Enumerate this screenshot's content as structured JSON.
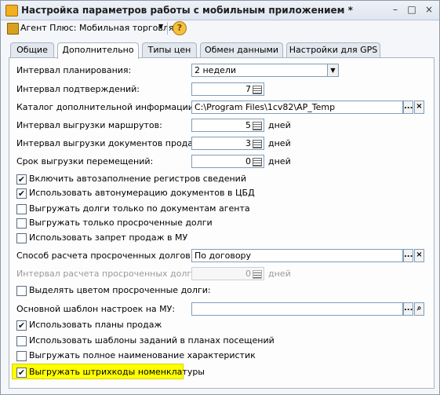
{
  "window": {
    "title": "Настройка параметров работы с мобильным приложением *",
    "buttons": {
      "minimize": "–",
      "maximize": "□",
      "close": "×"
    }
  },
  "toolbar": {
    "agent_menu_label": "Агент Плюс: Мобильная торговля",
    "help_label": "?"
  },
  "tabs": [
    {
      "label": "Общие",
      "active": false
    },
    {
      "label": "Дополнительно",
      "active": true
    },
    {
      "label": "Типы цен",
      "active": false
    },
    {
      "label": "Обмен данными",
      "active": false
    },
    {
      "label": "Настройки для GPS",
      "active": false
    }
  ],
  "form": {
    "planning_interval": {
      "label": "Интервал планирования:",
      "value": "2 недели"
    },
    "confirmation_interval": {
      "label": "Интервал подтверждений:",
      "value": "7"
    },
    "extra_info_dir": {
      "label": "Каталог дополнительной информации:",
      "value": "C:\\Program Files\\1cv82\\AP_Temp"
    },
    "routes_export_interval": {
      "label": "Интервал выгрузки маршрутов:",
      "value": "5",
      "unit": "дней"
    },
    "sales_docs_export_interval": {
      "label": "Интервал выгрузки документов продаж:",
      "value": "3",
      "unit": "дней"
    },
    "transfers_export_period": {
      "label": "Срок выгрузки перемещений:",
      "value": "0",
      "unit": "дней"
    },
    "checkboxes_a": [
      {
        "label": "Включить автозаполнение регистров сведений",
        "checked": true
      },
      {
        "label": "Использовать автонумерацию документов в ЦБД",
        "checked": true
      },
      {
        "label": "Выгружать долги только по документам агента",
        "checked": false
      },
      {
        "label": "Выгружать только просроченные долги",
        "checked": false
      },
      {
        "label": "Использовать запрет продаж в МУ",
        "checked": false
      }
    ],
    "overdue_calc_method": {
      "label": "Способ расчета просроченных долгов:",
      "value": "По договору"
    },
    "overdue_calc_interval": {
      "label": "Интервал расчета просроченных долгов:",
      "value": "0",
      "unit": "дней"
    },
    "highlight_overdue": {
      "label": "Выделять цветом просроченные долги:",
      "checked": false
    },
    "main_template": {
      "label": "Основной шаблон настроек на МУ:",
      "value": ""
    },
    "checkboxes_b": [
      {
        "label": "Использовать планы продаж",
        "checked": true
      },
      {
        "label": "Использовать шаблоны заданий в планах посещений",
        "checked": false
      },
      {
        "label": "Выгружать полное наименование характеристик",
        "checked": false
      },
      {
        "label": "Выгружать штрихкоды номенклатуры",
        "checked": true
      }
    ]
  },
  "glyphs": {
    "check": "✔",
    "caret": "▼",
    "ellipsis": "...",
    "clear": "×",
    "search": "⌕"
  },
  "colors": {
    "highlight": "#ffff00",
    "accent": "#f0b020"
  }
}
